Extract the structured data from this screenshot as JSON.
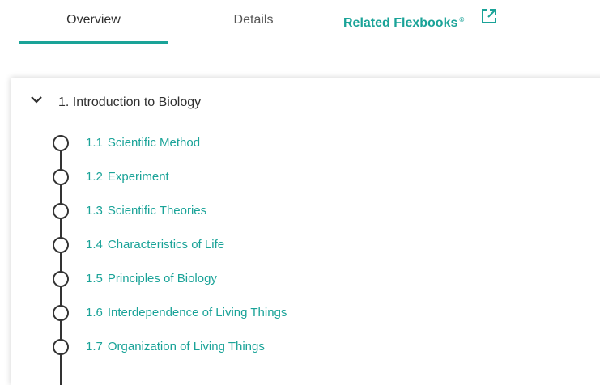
{
  "tabs": {
    "overview": "Overview",
    "details": "Details",
    "related": "Related Flexbooks",
    "related_mark": "®"
  },
  "chapter": {
    "title": "1. Introduction to Biology",
    "lessons": [
      {
        "number": "1.1",
        "title": "Scientific Method"
      },
      {
        "number": "1.2",
        "title": "Experiment"
      },
      {
        "number": "1.3",
        "title": "Scientific Theories"
      },
      {
        "number": "1.4",
        "title": "Characteristics of Life"
      },
      {
        "number": "1.5",
        "title": "Principles of Biology"
      },
      {
        "number": "1.6",
        "title": "Interdependence of Living Things"
      },
      {
        "number": "1.7",
        "title": "Organization of Living Things"
      }
    ]
  },
  "icons": {
    "external": "external-link-icon",
    "chevron": "chevron-down-icon",
    "step": "circle-step-icon"
  },
  "colors": {
    "accent": "#1aa398",
    "text": "#2f2f2f",
    "muted": "#555555"
  }
}
